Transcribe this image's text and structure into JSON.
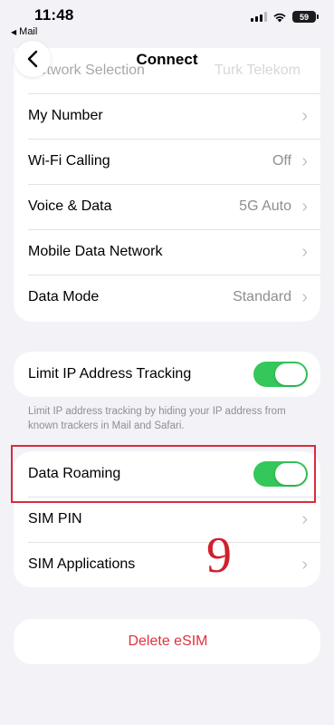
{
  "status_bar": {
    "time": "11:48",
    "back_app": "Mail",
    "battery": "59"
  },
  "nav": {
    "title": "Connect"
  },
  "top_group": [
    {
      "label": "Network Selection",
      "value": "Turk Telekom"
    },
    {
      "label": "My Number",
      "value": ""
    },
    {
      "label": "Wi-Fi Calling",
      "value": "Off"
    },
    {
      "label": "Voice & Data",
      "value": "5G Auto"
    },
    {
      "label": "Mobile Data Network",
      "value": ""
    },
    {
      "label": "Data Mode",
      "value": "Standard"
    }
  ],
  "limit_ip": {
    "label": "Limit IP Address Tracking",
    "enabled": true,
    "footnote": "Limit IP address tracking by hiding your IP address from known trackers in Mail and Safari."
  },
  "roaming_group": {
    "data_roaming": {
      "label": "Data Roaming",
      "enabled": true
    },
    "sim_pin": {
      "label": "SIM PIN"
    },
    "sim_applications": {
      "label": "SIM Applications"
    }
  },
  "delete_esim": {
    "label": "Delete eSIM"
  },
  "annotation": {
    "step": "9"
  },
  "colors": {
    "toggle_on": "#34c759",
    "destructive": "#e0323f",
    "highlight": "#d62e3b"
  }
}
